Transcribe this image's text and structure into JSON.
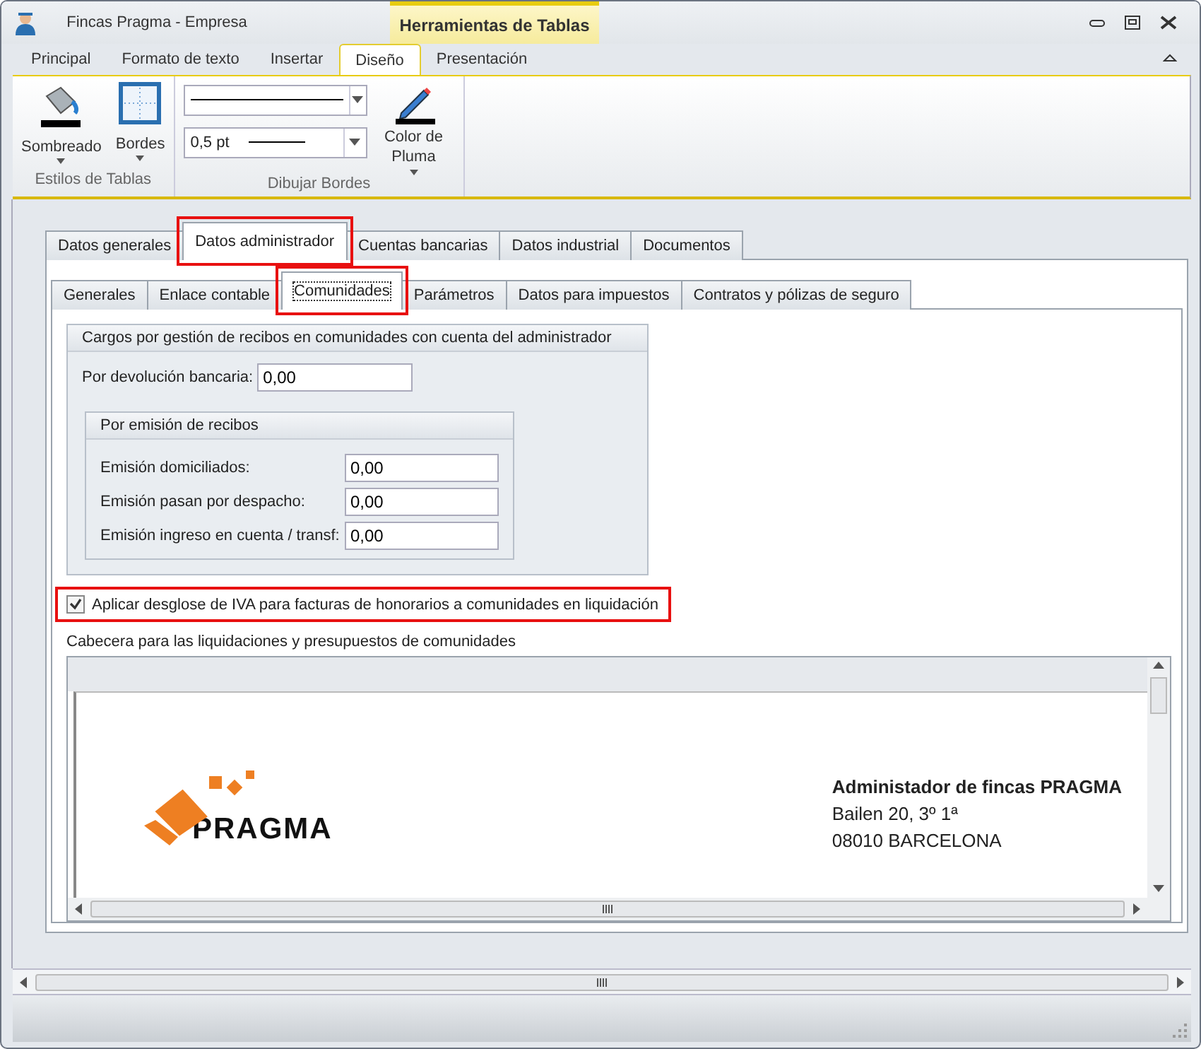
{
  "window": {
    "title": "Fincas Pragma - Empresa",
    "context_tab": "Herramientas de Tablas"
  },
  "ribbon_tabs": [
    {
      "label": "Principal",
      "selected": false
    },
    {
      "label": "Formato de texto",
      "selected": false
    },
    {
      "label": "Insertar",
      "selected": false
    },
    {
      "label": "Diseño",
      "selected": true
    },
    {
      "label": "Presentación",
      "selected": false
    }
  ],
  "ribbon_groups": [
    {
      "label": "Estilos de Tablas",
      "buttons": [
        "Sombreado",
        "Bordes"
      ]
    },
    {
      "label": "Dibujar Bordes",
      "pen_weight": "0,5 pt",
      "pen_color_label": "Color de Pluma"
    }
  ],
  "main_tabs": [
    {
      "label": "Datos generales",
      "selected": false,
      "highlighted": false
    },
    {
      "label": "Datos administrador",
      "selected": true,
      "highlighted": true
    },
    {
      "label": "Cuentas bancarias",
      "selected": false,
      "highlighted": false
    },
    {
      "label": "Datos industrial",
      "selected": false,
      "highlighted": false
    },
    {
      "label": "Documentos",
      "selected": false,
      "highlighted": false
    }
  ],
  "sub_tabs": [
    {
      "label": "Generales",
      "selected": false,
      "highlighted": false
    },
    {
      "label": "Enlace contable",
      "selected": false,
      "highlighted": false
    },
    {
      "label": "Comunidades",
      "selected": true,
      "highlighted": true
    },
    {
      "label": "Parámetros",
      "selected": false,
      "highlighted": false
    },
    {
      "label": "Datos para impuestos",
      "selected": false,
      "highlighted": false
    },
    {
      "label": "Contratos y pólizas de seguro",
      "selected": false,
      "highlighted": false
    }
  ],
  "charges_group": {
    "title": "Cargos por gestión de recibos en comunidades con cuenta del administrador",
    "field": {
      "label": "Por devolución bancaria:",
      "value": "0,00"
    },
    "subgroup": {
      "title": "Por emisión de recibos",
      "fields": [
        {
          "label": "Emisión domiciliados:",
          "value": "0,00"
        },
        {
          "label": "Emisión pasan por despacho:",
          "value": "0,00"
        },
        {
          "label": "Emisión ingreso en cuenta / transf:",
          "value": "0,00"
        }
      ]
    }
  },
  "iva_checkbox": {
    "label": "Aplicar desglose de IVA para facturas de honorarios a comunidades en liquidación",
    "checked": true,
    "highlighted": true
  },
  "header_editor": {
    "label": "Cabecera para las liquidaciones y presupuestos de comunidades",
    "logo_text": "PRAGMA",
    "company": "Administador de fincas PRAGMA",
    "address": [
      "Bailen 20, 3º 1ª",
      "08010 BARCELONA"
    ]
  }
}
